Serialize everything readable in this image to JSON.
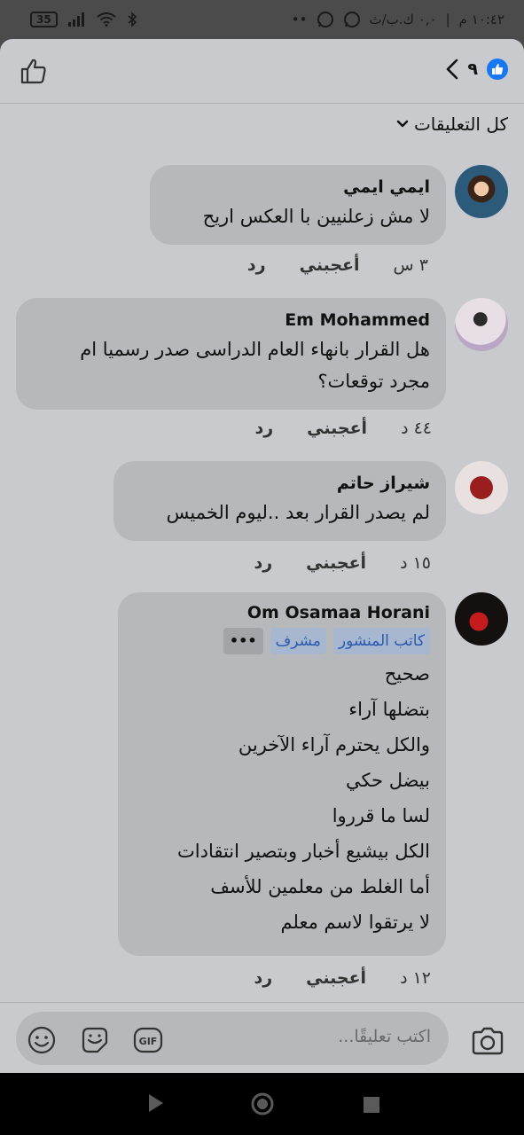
{
  "status_bar": {
    "time": "١٠:٤٢ م",
    "network_speed": "٠,٠ ك.ب/ث",
    "battery": "35",
    "notif": "••"
  },
  "header": {
    "reaction_count": "٩"
  },
  "filter": {
    "label": "كل التعليقات"
  },
  "comments": [
    {
      "author": "ايمي ايمي",
      "lines": [
        "لا مش زعلنيين با العكس اريح"
      ],
      "time": "٣ س",
      "like_label": "أعجبني",
      "reply_label": "رد"
    },
    {
      "author": "Em Mohammed",
      "lines": [
        "هل القرار بانهاء العام الدراسى صدر رسميا ام",
        "مجرد توقعات؟"
      ],
      "time": "٤٤ د",
      "like_label": "أعجبني",
      "reply_label": "رد"
    },
    {
      "author": "شيراز حاتم",
      "lines": [
        "لم يصدر القرار بعد ..ليوم الخميس"
      ],
      "time": "١٥ د",
      "like_label": "أعجبني",
      "reply_label": "رد"
    },
    {
      "author": "Om Osamaa Horani",
      "badges": [
        "كاتب المنشور",
        "مشرف"
      ],
      "more_label": "•••",
      "lines": [
        "صحيح",
        "بتضلها آراء",
        "والكل يحترم آراء الآخرين",
        "بيضل حكي",
        "لسا ما قرروا",
        "الكل بيشيع أخبار وبتصير انتقادات",
        "أما الغلط من معلمين للأسف",
        "لا يرتقوا لاسم معلم"
      ],
      "time": "١٢ د",
      "like_label": "أعجبني",
      "reply_label": "رد"
    }
  ],
  "composer": {
    "placeholder": "اكتب تعليقًا...",
    "gif_label": "GIF"
  }
}
